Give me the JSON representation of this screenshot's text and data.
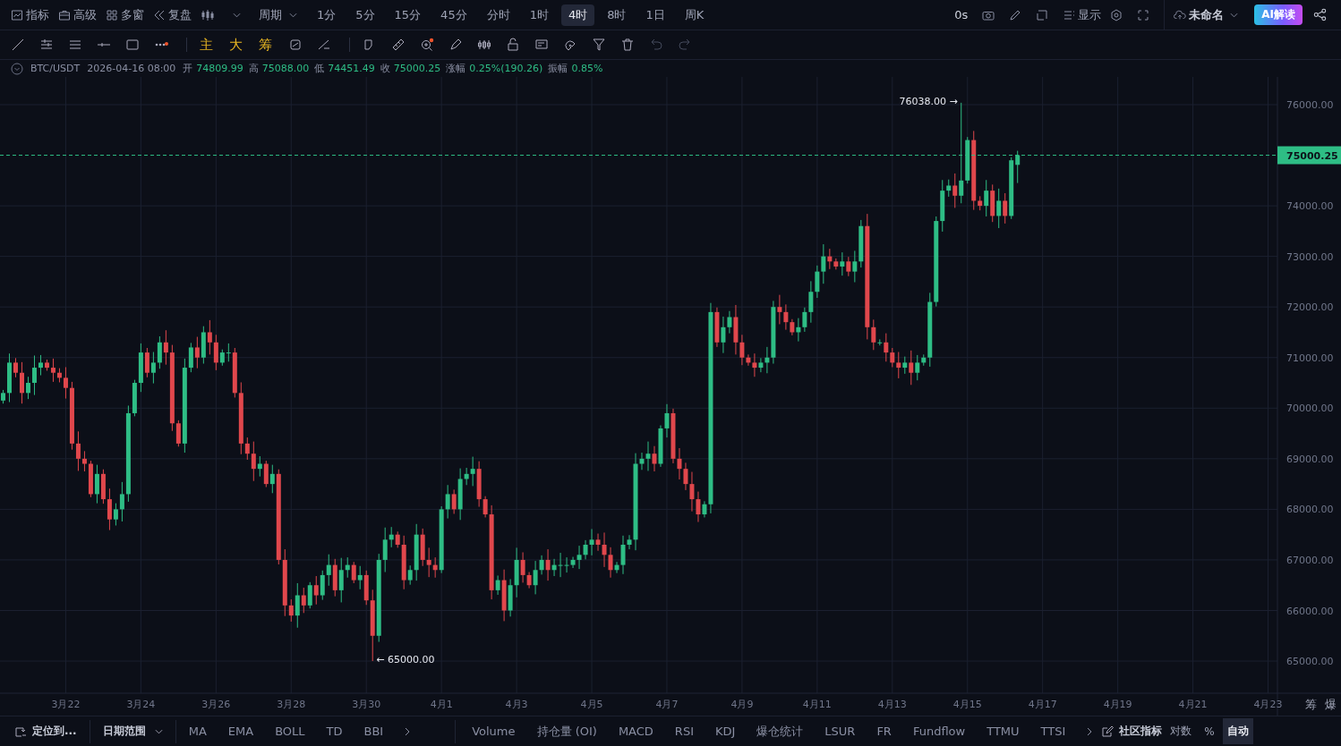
{
  "top_bar": {
    "menus": [
      {
        "label": "指标"
      },
      {
        "label": "高级"
      },
      {
        "label": "多窗"
      },
      {
        "label": "复盘"
      }
    ],
    "period_label": "周期",
    "periods": [
      {
        "label": "1分",
        "selected": false
      },
      {
        "label": "5分",
        "selected": false
      },
      {
        "label": "15分",
        "selected": false
      },
      {
        "label": "45分",
        "selected": false
      },
      {
        "label": "分时",
        "selected": false
      },
      {
        "label": "1时",
        "selected": false
      },
      {
        "label": "4时",
        "selected": true
      },
      {
        "label": "8时",
        "selected": false
      },
      {
        "label": "1日",
        "selected": false
      },
      {
        "label": "周K",
        "selected": false
      }
    ],
    "countdown": "0s",
    "display_label": "显示",
    "layout_name": "未命名",
    "ai_button": "AI解读"
  },
  "toolbar": {
    "text_tools": [
      "主",
      "大",
      "筹"
    ]
  },
  "info": {
    "symbol": "BTC/USDT",
    "time": "2026-04-16 08:00",
    "fields": [
      {
        "label": "开",
        "value": "74809.99"
      },
      {
        "label": "高",
        "value": "75088.00"
      },
      {
        "label": "低",
        "value": "74451.49"
      },
      {
        "label": "收",
        "value": "75000.25"
      },
      {
        "label": "涨幅",
        "value": "0.25%(190.26)"
      },
      {
        "label": "振幅",
        "value": "0.85%"
      }
    ]
  },
  "chart": {
    "axis_corner": [
      "筹",
      "爆"
    ],
    "chart_data": {
      "type": "candlestick",
      "grid": true,
      "ylim": [
        64360,
        76480
      ],
      "categories": [
        null,
        null,
        null,
        null,
        null,
        null,
        null,
        null,
        null,
        null,
        "3月22",
        null,
        null,
        null,
        null,
        null,
        null,
        null,
        null,
        null,
        null,
        null,
        "3月24",
        null,
        null,
        null,
        null,
        null,
        null,
        null,
        null,
        null,
        null,
        null,
        "3月26",
        null,
        null,
        null,
        null,
        null,
        null,
        null,
        null,
        null,
        null,
        null,
        "3月28",
        null,
        null,
        null,
        null,
        null,
        null,
        null,
        null,
        null,
        null,
        null,
        "3月30",
        null,
        null,
        null,
        null,
        null,
        null,
        null,
        null,
        null,
        null,
        null,
        "4月1",
        null,
        null,
        null,
        null,
        null,
        null,
        null,
        null,
        null,
        null,
        null,
        "4月3",
        null,
        null,
        null,
        null,
        null,
        null,
        null,
        null,
        null,
        null,
        null,
        "4月5",
        null,
        null,
        null,
        null,
        null,
        null,
        null,
        null,
        null,
        null,
        null,
        "4月7",
        null,
        null,
        null,
        null,
        null,
        null,
        null,
        null,
        null,
        null,
        null,
        "4月9",
        null,
        null,
        null,
        null,
        null,
        null,
        null,
        null,
        null,
        null,
        null,
        "4月11",
        null,
        null,
        null,
        null,
        null,
        null,
        null,
        null,
        null,
        null,
        null,
        "4月13",
        null,
        null,
        null,
        null,
        null,
        null,
        null,
        null,
        null,
        null,
        null,
        "4月15",
        null,
        null,
        null,
        null,
        null,
        null,
        null,
        null,
        null,
        null,
        null,
        "4月17",
        null,
        null,
        null,
        null,
        null,
        null,
        null,
        null,
        null,
        null,
        null,
        "4月19",
        null,
        null,
        null,
        null,
        null,
        null,
        null,
        null,
        null,
        null,
        null,
        "4月21",
        null,
        null,
        null,
        null,
        null,
        null,
        null,
        null,
        null,
        null,
        null,
        "4月23",
        null
      ],
      "ohlc": [
        [
          70150,
          70360,
          70090,
          70300
        ],
        [
          70300,
          71080,
          70120,
          70900
        ],
        [
          70900,
          70990,
          70610,
          70700
        ],
        [
          70700,
          70910,
          70090,
          70300
        ],
        [
          70300,
          70620,
          70180,
          70500
        ],
        [
          70500,
          71040,
          70260,
          70800
        ],
        [
          70800,
          71050,
          70650,
          70900
        ],
        [
          70900,
          70960,
          70740,
          70800
        ],
        [
          70800,
          70980,
          70520,
          70700
        ],
        [
          70700,
          70790,
          70510,
          70600
        ],
        [
          70600,
          70810,
          70190,
          70400
        ],
        [
          70400,
          70520,
          69180,
          69300
        ],
        [
          69300,
          69540,
          68760,
          69000
        ],
        [
          69000,
          69150,
          68750,
          68900
        ],
        [
          68900,
          68960,
          68240,
          68300
        ],
        [
          68300,
          68880,
          68120,
          68700
        ],
        [
          68700,
          68790,
          68110,
          68200
        ],
        [
          68200,
          68410,
          67590,
          67800
        ],
        [
          67800,
          68120,
          67680,
          68000
        ],
        [
          68000,
          68540,
          67760,
          68300
        ],
        [
          68300,
          70050,
          68150,
          69900
        ],
        [
          69900,
          70560,
          69840,
          70500
        ],
        [
          70500,
          71280,
          70320,
          71100
        ],
        [
          71100,
          71190,
          70610,
          70700
        ],
        [
          70700,
          71110,
          70490,
          70900
        ],
        [
          70900,
          71420,
          70780,
          71300
        ],
        [
          71300,
          71540,
          70860,
          71100
        ],
        [
          71100,
          71250,
          69550,
          69700
        ],
        [
          69700,
          69760,
          69240,
          69300
        ],
        [
          69300,
          70980,
          69120,
          70800
        ],
        [
          70800,
          71290,
          70710,
          71200
        ],
        [
          71200,
          71410,
          70790,
          71000
        ],
        [
          71000,
          71620,
          70880,
          71500
        ],
        [
          71500,
          71740,
          71060,
          71300
        ],
        [
          71300,
          71450,
          70750,
          70900
        ],
        [
          70900,
          71160,
          70840,
          71100
        ],
        [
          71100,
          71280,
          70920,
          71100
        ],
        [
          71100,
          71190,
          70210,
          70300
        ],
        [
          70300,
          70510,
          69090,
          69300
        ],
        [
          69300,
          69420,
          68980,
          69100
        ],
        [
          69100,
          69340,
          68560,
          68800
        ],
        [
          68800,
          69050,
          68650,
          68900
        ],
        [
          68900,
          68960,
          68440,
          68500
        ],
        [
          68500,
          68880,
          68320,
          68700
        ],
        [
          68700,
          68790,
          66910,
          67000
        ],
        [
          67000,
          67210,
          65890,
          66100
        ],
        [
          66100,
          66220,
          65780,
          65900
        ],
        [
          65900,
          66540,
          65660,
          66300
        ],
        [
          66300,
          66450,
          65950,
          66100
        ],
        [
          66100,
          66560,
          66040,
          66500
        ],
        [
          66500,
          66680,
          66120,
          66300
        ],
        [
          66300,
          66790,
          66210,
          66700
        ],
        [
          66700,
          67110,
          66490,
          66900
        ],
        [
          66900,
          67020,
          66280,
          66400
        ],
        [
          66400,
          67040,
          66160,
          66800
        ],
        [
          66800,
          67050,
          66650,
          66900
        ],
        [
          66900,
          66960,
          66540,
          66600
        ],
        [
          66600,
          66880,
          66420,
          66700
        ],
        [
          66700,
          66790,
          66110,
          66200
        ],
        [
          66200,
          66410,
          65000,
          65500
        ],
        [
          65500,
          67120,
          65380,
          67000
        ],
        [
          67000,
          67640,
          66760,
          67400
        ],
        [
          67400,
          67650,
          67250,
          67500
        ],
        [
          67500,
          67560,
          67240,
          67300
        ],
        [
          67300,
          67480,
          66420,
          66600
        ],
        [
          66600,
          66890,
          66510,
          66800
        ],
        [
          66800,
          67710,
          66590,
          67500
        ],
        [
          67500,
          67620,
          66880,
          67000
        ],
        [
          67000,
          67240,
          66660,
          66900
        ],
        [
          66900,
          67050,
          66650,
          66800
        ],
        [
          66800,
          68060,
          66740,
          68000
        ],
        [
          68000,
          68480,
          67820,
          68300
        ],
        [
          68300,
          68390,
          67910,
          68000
        ],
        [
          68000,
          68810,
          67790,
          68600
        ],
        [
          68600,
          68820,
          68480,
          68700
        ],
        [
          68700,
          69040,
          68460,
          68800
        ],
        [
          68800,
          68950,
          68050,
          68200
        ],
        [
          68200,
          68260,
          67840,
          67900
        ],
        [
          67900,
          68080,
          66220,
          66400
        ],
        [
          66400,
          66690,
          66310,
          66600
        ],
        [
          66600,
          66810,
          65790,
          66000
        ],
        [
          66000,
          66620,
          65880,
          66500
        ],
        [
          66500,
          67240,
          66260,
          67000
        ],
        [
          67000,
          67150,
          66550,
          66700
        ],
        [
          66700,
          66760,
          66440,
          66500
        ],
        [
          66500,
          66980,
          66320,
          66800
        ],
        [
          66800,
          67090,
          66710,
          67000
        ],
        [
          67000,
          67210,
          66590,
          66800
        ],
        [
          66800,
          67020,
          66680,
          66900
        ],
        [
          66900,
          67140,
          66660,
          66900
        ],
        [
          66900,
          67050,
          66750,
          66900
        ],
        [
          66900,
          67060,
          66840,
          67000
        ],
        [
          67000,
          67280,
          66820,
          67100
        ],
        [
          67100,
          67390,
          67010,
          67300
        ],
        [
          67300,
          67610,
          67090,
          67400
        ],
        [
          67400,
          67520,
          67180,
          67300
        ],
        [
          67300,
          67540,
          66860,
          67100
        ],
        [
          67100,
          67250,
          66650,
          66800
        ],
        [
          66800,
          66960,
          66740,
          66900
        ],
        [
          66900,
          67480,
          66720,
          67300
        ],
        [
          67300,
          67490,
          67210,
          67400
        ],
        [
          67400,
          69110,
          67190,
          68900
        ],
        [
          68900,
          69120,
          68780,
          69000
        ],
        [
          69000,
          69340,
          68760,
          69100
        ],
        [
          69100,
          69250,
          68750,
          68900
        ],
        [
          68900,
          69660,
          68840,
          69600
        ],
        [
          69600,
          70080,
          69420,
          69900
        ],
        [
          69900,
          69990,
          68910,
          69000
        ],
        [
          69000,
          69210,
          68590,
          68800
        ],
        [
          68800,
          68920,
          68380,
          68500
        ],
        [
          68500,
          68740,
          67960,
          68200
        ],
        [
          68200,
          68350,
          67750,
          67900
        ],
        [
          67900,
          68160,
          67840,
          68100
        ],
        [
          68100,
          72080,
          67920,
          71900
        ],
        [
          71900,
          71990,
          71210,
          71300
        ],
        [
          71300,
          71810,
          71090,
          71600
        ],
        [
          71600,
          71920,
          71480,
          71800
        ],
        [
          71800,
          72040,
          71060,
          71300
        ],
        [
          71300,
          71450,
          70850,
          71000
        ],
        [
          71000,
          71060,
          70840,
          70900
        ],
        [
          70900,
          71080,
          70620,
          70800
        ],
        [
          70800,
          70990,
          70710,
          70900
        ],
        [
          70900,
          71210,
          70690,
          71000
        ],
        [
          71000,
          72120,
          70880,
          72000
        ],
        [
          72000,
          72240,
          71660,
          71900
        ],
        [
          71900,
          72050,
          71550,
          71700
        ],
        [
          71700,
          71760,
          71440,
          71500
        ],
        [
          71500,
          71780,
          71320,
          71600
        ],
        [
          71600,
          71990,
          71510,
          71900
        ],
        [
          71900,
          72510,
          71690,
          72300
        ],
        [
          72300,
          72820,
          72180,
          72700
        ],
        [
          72700,
          73240,
          72460,
          73000
        ],
        [
          73000,
          73150,
          72750,
          72900
        ],
        [
          72900,
          72960,
          72740,
          72800
        ],
        [
          72800,
          73080,
          72620,
          72900
        ],
        [
          72900,
          72990,
          72610,
          72700
        ],
        [
          72700,
          73110,
          72490,
          72900
        ],
        [
          72900,
          73720,
          72780,
          73600
        ],
        [
          73600,
          73840,
          71360,
          71600
        ],
        [
          71600,
          71750,
          71150,
          71300
        ],
        [
          71300,
          71360,
          71240,
          71300
        ],
        [
          71300,
          71480,
          70920,
          71100
        ],
        [
          71100,
          71190,
          70810,
          70900
        ],
        [
          70900,
          71110,
          70590,
          70800
        ],
        [
          70800,
          71020,
          70680,
          70900
        ],
        [
          70900,
          71140,
          70460,
          70700
        ],
        [
          70700,
          71050,
          70550,
          70900
        ],
        [
          70900,
          71060,
          70840,
          71000
        ],
        [
          71000,
          72280,
          70820,
          72100
        ],
        [
          72100,
          73790,
          72010,
          73700
        ],
        [
          73700,
          74510,
          73490,
          74300
        ],
        [
          74300,
          74520,
          74180,
          74400
        ],
        [
          74400,
          74640,
          73960,
          74200
        ],
        [
          74200,
          76038,
          74050,
          74500
        ],
        [
          74500,
          75360,
          74440,
          75300
        ],
        [
          75300,
          75480,
          73920,
          74100
        ],
        [
          74100,
          74190,
          73910,
          74000
        ],
        [
          74000,
          74510,
          73790,
          74300
        ],
        [
          74300,
          74420,
          73680,
          73800
        ],
        [
          73800,
          74340,
          73560,
          74100
        ],
        [
          74100,
          74250,
          73650,
          73800
        ],
        [
          73800,
          74960,
          73740,
          74900
        ],
        [
          74809.99,
          75088,
          74451.49,
          75000.25
        ],
        null,
        null,
        null,
        null,
        null,
        null,
        null,
        null,
        null,
        null,
        null,
        null,
        null,
        null,
        null,
        null,
        null,
        null,
        null,
        null,
        null,
        null,
        null,
        null,
        null,
        null,
        null,
        null,
        null,
        null,
        null,
        null,
        null,
        null,
        null,
        null,
        null,
        null,
        null,
        null,
        null
      ],
      "yticks": [
        {
          "value": 65000,
          "label": "65000.00"
        },
        {
          "value": 66000,
          "label": "66000.00"
        },
        {
          "value": 67000,
          "label": "67000.00"
        },
        {
          "value": 68000,
          "label": "68000.00"
        },
        {
          "value": 69000,
          "label": "69000.00"
        },
        {
          "value": 70000,
          "label": "70000.00"
        },
        {
          "value": 71000,
          "label": "71000.00"
        },
        {
          "value": 72000,
          "label": "72000.00"
        },
        {
          "value": 73000,
          "label": "73000.00"
        },
        {
          "value": 74000,
          "label": "74000.00"
        },
        {
          "value": 76000,
          "label": "76000.00"
        }
      ],
      "ref_lines": [
        {
          "axis": "y",
          "value": 75000.25,
          "label": "75000.25",
          "color": "#2ebd85"
        }
      ],
      "annotations": [
        "76038.00 →",
        "← 65000.00"
      ]
    }
  },
  "bottom_bar": {
    "locate": "定位到...",
    "date_range": "日期范围",
    "main_indicators": [
      "MA",
      "EMA",
      "BOLL",
      "TD",
      "BBI"
    ],
    "sub_indicators": [
      "Volume",
      "持仓量 (OI)",
      "MACD",
      "RSI",
      "KDJ",
      "爆仓统计",
      "LSUR",
      "FR",
      "Fundflow",
      "TTMU",
      "TTSI"
    ],
    "community": "社区指标",
    "scale_options": [
      {
        "label": "对数",
        "selected": false
      },
      {
        "label": "%",
        "selected": false
      },
      {
        "label": "自动",
        "selected": true
      }
    ]
  }
}
